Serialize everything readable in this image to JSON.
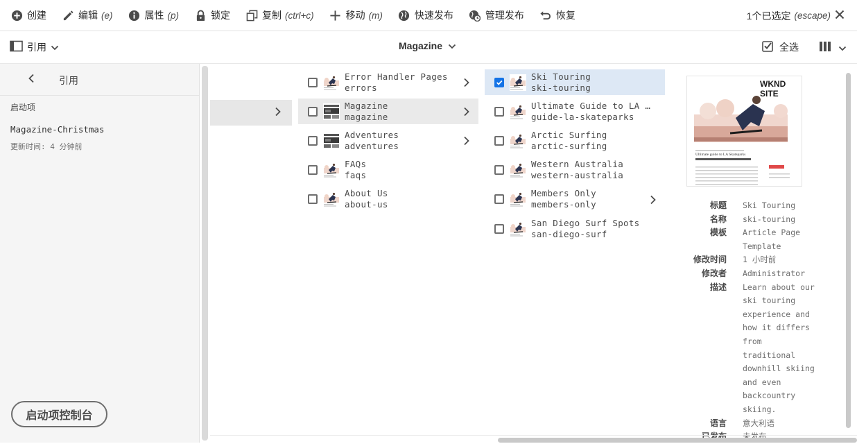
{
  "toolbar": {
    "create": "创建",
    "edit": "编辑",
    "edit_sc": "(e)",
    "properties": "属性",
    "properties_sc": "(p)",
    "lock": "锁定",
    "copy": "复制",
    "copy_sc": "(ctrl+c)",
    "move": "移动",
    "move_sc": "(m)",
    "quick_publish": "快速发布",
    "manage_publication": "管理发布",
    "restore": "恢复",
    "selection_count": "1个已选定",
    "selection_sc": "(escape)"
  },
  "subbar": {
    "rail_label": "引用",
    "view_title": "Magazine",
    "select_all": "全选"
  },
  "rail": {
    "title": "引用",
    "section": "启动项",
    "launch_name": "Magazine-Christmas",
    "launch_updated": "更新时间: 4 分钟前",
    "console_button": "启动项控制台"
  },
  "column1": [
    {
      "title": "Error Handler Pages",
      "name": "errors",
      "has_children": true
    },
    {
      "title": "Magazine",
      "name": "magazine",
      "has_children": true
    },
    {
      "title": "Adventures",
      "name": "adventures",
      "has_children": true
    },
    {
      "title": "FAQs",
      "name": "faqs",
      "has_children": false
    },
    {
      "title": "About Us",
      "name": "about-us",
      "has_children": false
    }
  ],
  "column2": [
    {
      "title": "Ski Touring",
      "name": "ski-touring",
      "selected": true,
      "has_children": false
    },
    {
      "title": "Ultimate Guide to LA S…",
      "name": "guide-la-skateparks",
      "selected": false,
      "has_children": false
    },
    {
      "title": "Arctic Surfing",
      "name": "arctic-surfing",
      "selected": false,
      "has_children": false
    },
    {
      "title": "Western Australia",
      "name": "western-australia",
      "selected": false,
      "has_children": false
    },
    {
      "title": "Members Only",
      "name": "members-only",
      "selected": false,
      "has_children": true
    },
    {
      "title": "San Diego Surf Spots",
      "name": "san-diego-surf",
      "selected": false,
      "has_children": false
    }
  ],
  "preview": {
    "site_name": "WKND SITE",
    "article_headline": "Ultimate guide to LA Skateparks"
  },
  "meta": [
    {
      "key": "标题",
      "value": "Ski Touring"
    },
    {
      "key": "名称",
      "value": "ski-touring"
    },
    {
      "key": "模板",
      "value": "Article Page Template"
    },
    {
      "key": "修改时间",
      "value": "1 小时前"
    },
    {
      "key": "修改者",
      "value": "Administrator"
    },
    {
      "key": "描述",
      "value": "Learn about our ski touring experience and how it differs from traditional downhill skiing and even backcountry skiing."
    },
    {
      "key": "语言",
      "value": "意大利语"
    },
    {
      "key": "已发布",
      "value": "未发布"
    }
  ],
  "colors": {
    "accent": "#1473e6",
    "selected_row": "#dde8f5",
    "rail_bg": "#f5f5f5"
  }
}
